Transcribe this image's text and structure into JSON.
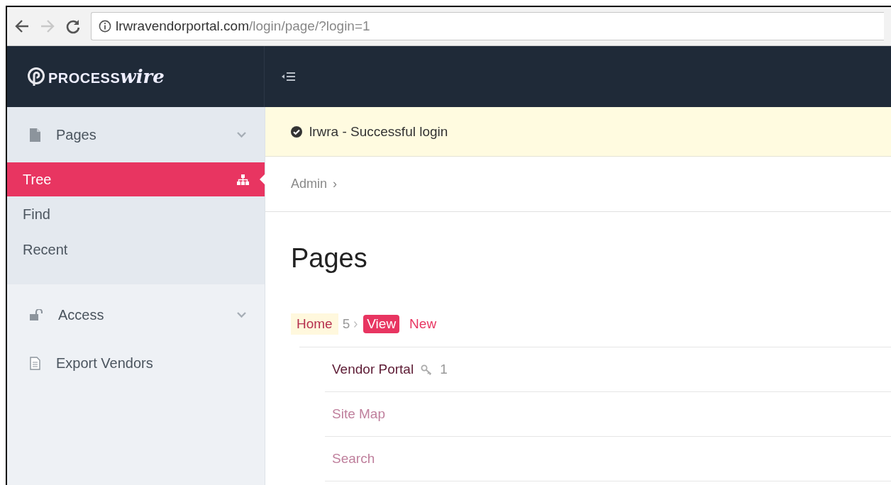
{
  "browser": {
    "forward_disabled": true,
    "url_host": "lrwravendorportal.com",
    "url_path": "/login/page/?login=1"
  },
  "logo": {
    "prefix": "PROCESS",
    "suffix": "wire"
  },
  "sidebar": {
    "groups": [
      {
        "label": "Pages",
        "kind": "menu",
        "items": [
          {
            "label": "Tree",
            "selected": true
          },
          {
            "label": "Find",
            "selected": false
          },
          {
            "label": "Recent",
            "selected": false
          }
        ]
      },
      {
        "label": "Access",
        "kind": "menu"
      },
      {
        "label": "Export Vendors",
        "kind": "link"
      }
    ]
  },
  "notice": {
    "text": "lrwra - Successful login"
  },
  "breadcrumbs": [
    {
      "label": "Admin",
      "separator": "›"
    }
  ],
  "heading": "Pages",
  "tree": {
    "title": "Home",
    "count": "5",
    "actions": [
      {
        "label": "View",
        "kind": "primary"
      },
      {
        "label": "New",
        "kind": "link"
      }
    ],
    "children": [
      {
        "title": "Vendor Portal",
        "hidden": false,
        "locked": true,
        "count": "1"
      },
      {
        "title": "Site Map",
        "hidden": true,
        "locked": false
      },
      {
        "title": "Search",
        "hidden": true,
        "locked": false
      }
    ]
  }
}
